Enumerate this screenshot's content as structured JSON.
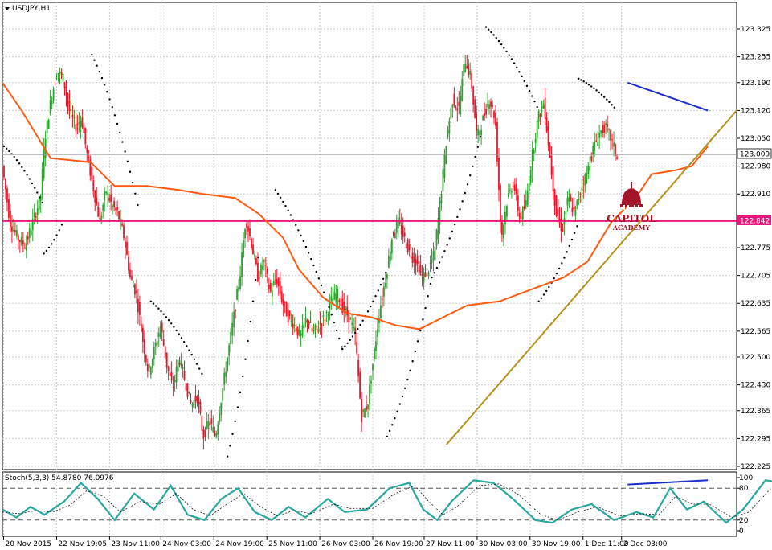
{
  "chart_data": [
    {
      "type": "line",
      "title": "USDJPY,H1",
      "price_tag_current": "123.009",
      "price_tag_level": "122.842",
      "y_ticks": [
        "123.325",
        "123.255",
        "123.190",
        "123.120",
        "123.050",
        "122.980",
        "122.910",
        "122.842",
        "122.775",
        "122.705",
        "122.635",
        "122.565",
        "122.500",
        "122.430",
        "122.365",
        "122.295",
        "122.225"
      ],
      "y_tick_values": [
        123.325,
        123.255,
        123.19,
        123.12,
        123.05,
        122.98,
        122.91,
        122.842,
        122.775,
        122.705,
        122.635,
        122.565,
        122.5,
        122.43,
        122.365,
        122.295,
        122.225
      ],
      "ylim": [
        122.215,
        123.365
      ],
      "x_ticks": [
        "20 Nov 2015",
        "22 Nov 19:05",
        "23 Nov 11:00",
        "24 Nov 03:00",
        "24 Nov 19:00",
        "25 Nov 11:00",
        "26 Nov 03:00",
        "26 Nov 19:00",
        "27 Nov 11:00",
        "30 Nov 03:00",
        "30 Nov 19:00",
        "1 Dec 11:00",
        "2 Dec 03:00"
      ],
      "horizontal_levels": [
        {
          "price": 122.842,
          "color": "#e8177a"
        },
        {
          "price": 123.009,
          "color": "#9a9a9a"
        }
      ],
      "series": [
        {
          "kind": "moving_average",
          "color": "#ff5a12",
          "points": [
            [
              0,
              123.19
            ],
            [
              12,
              123.12
            ],
            [
              30,
              123.0
            ],
            [
              55,
              122.99
            ],
            [
              70,
              122.93
            ],
            [
              90,
              122.93
            ],
            [
              110,
              122.92
            ],
            [
              125,
              122.91
            ],
            [
              145,
              122.9
            ],
            [
              160,
              122.86
            ],
            [
              175,
              122.8
            ],
            [
              185,
              122.72
            ],
            [
              200,
              122.65
            ],
            [
              215,
              122.61
            ],
            [
              230,
              122.6
            ],
            [
              245,
              122.58
            ],
            [
              260,
              122.57
            ],
            [
              275,
              122.6
            ],
            [
              290,
              122.63
            ],
            [
              310,
              122.64
            ],
            [
              330,
              122.67
            ],
            [
              350,
              122.7
            ],
            [
              365,
              122.74
            ],
            [
              380,
              122.84
            ],
            [
              395,
              122.9
            ],
            [
              405,
              122.96
            ],
            [
              420,
              122.97
            ],
            [
              430,
              122.98
            ],
            [
              440,
              123.03
            ]
          ]
        },
        {
          "kind": "trendline",
          "color": "#b8901e",
          "points": [
            [
              277,
              122.28
            ],
            [
              458,
              123.12
            ]
          ]
        },
        {
          "kind": "resistance_line",
          "color": "#1c2ec8",
          "points": [
            [
              390,
              123.19
            ],
            [
              440,
              123.12
            ]
          ]
        }
      ]
    },
    {
      "type": "line",
      "title": "Stoch(5,3,3) 54.8780 76.0976",
      "ylim": [
        0,
        100
      ],
      "y_ticks": [
        "100",
        "80",
        "20",
        "0"
      ],
      "y_tick_values": [
        100,
        80,
        20,
        0
      ],
      "levels": [
        80,
        20
      ],
      "divergence_line": {
        "color": "#1c2ec8",
        "points": [
          [
            390,
            87
          ],
          [
            440,
            95
          ]
        ]
      },
      "series": [
        {
          "kind": "main",
          "color": "#2aa8a0",
          "values": [
            [
              0,
              40
            ],
            [
              5,
              25
            ],
            [
              10,
              45
            ],
            [
              15,
              30
            ],
            [
              22,
              55
            ],
            [
              28,
              90
            ],
            [
              34,
              60
            ],
            [
              40,
              20
            ],
            [
              47,
              70
            ],
            [
              54,
              40
            ],
            [
              60,
              85
            ],
            [
              66,
              30
            ],
            [
              72,
              20
            ],
            [
              78,
              60
            ],
            [
              84,
              80
            ],
            [
              90,
              35
            ],
            [
              96,
              20
            ],
            [
              102,
              45
            ],
            [
              108,
              25
            ],
            [
              116,
              60
            ],
            [
              122,
              35
            ],
            [
              130,
              40
            ],
            [
              138,
              80
            ],
            [
              145,
              90
            ],
            [
              150,
              40
            ],
            [
              155,
              20
            ],
            [
              160,
              55
            ],
            [
              168,
              95
            ],
            [
              175,
              90
            ],
            [
              182,
              60
            ],
            [
              190,
              20
            ],
            [
              196,
              15
            ],
            [
              203,
              40
            ],
            [
              210,
              50
            ],
            [
              218,
              20
            ],
            [
              226,
              35
            ],
            [
              232,
              25
            ],
            [
              238,
              80
            ],
            [
              244,
              40
            ],
            [
              250,
              55
            ],
            [
              258,
              15
            ],
            [
              264,
              40
            ],
            [
              272,
              95
            ],
            [
              278,
              90
            ],
            [
              286,
              85
            ],
            [
              292,
              40
            ],
            [
              298,
              20
            ],
            [
              305,
              40
            ],
            [
              312,
              35
            ],
            [
              318,
              90
            ],
            [
              324,
              80
            ],
            [
              330,
              95
            ],
            [
              336,
              70
            ],
            [
              342,
              40
            ],
            [
              348,
              10
            ],
            [
              352,
              20
            ],
            [
              358,
              40
            ],
            [
              364,
              65
            ],
            [
              372,
              25
            ],
            [
              378,
              15
            ],
            [
              384,
              60
            ],
            [
              390,
              95
            ],
            [
              396,
              90
            ],
            [
              402,
              35
            ],
            [
              408,
              15
            ],
            [
              414,
              20
            ],
            [
              420,
              70
            ],
            [
              426,
              85
            ],
            [
              432,
              95
            ],
            [
              436,
              90
            ],
            [
              440,
              50
            ]
          ]
        },
        {
          "kind": "signal",
          "color": "#1a1a1a",
          "values": [
            [
              0,
              35
            ],
            [
              6,
              32
            ],
            [
              12,
              38
            ],
            [
              18,
              35
            ],
            [
              24,
              48
            ],
            [
              30,
              75
            ],
            [
              36,
              65
            ],
            [
              42,
              35
            ],
            [
              49,
              55
            ],
            [
              56,
              50
            ],
            [
              62,
              70
            ],
            [
              68,
              40
            ],
            [
              74,
              28
            ],
            [
              80,
              50
            ],
            [
              86,
              70
            ],
            [
              92,
              45
            ],
            [
              98,
              28
            ],
            [
              104,
              38
            ],
            [
              110,
              32
            ],
            [
              118,
              50
            ],
            [
              124,
              42
            ],
            [
              132,
              42
            ],
            [
              140,
              70
            ],
            [
              147,
              85
            ],
            [
              152,
              55
            ],
            [
              157,
              30
            ],
            [
              162,
              45
            ],
            [
              170,
              85
            ],
            [
              177,
              88
            ],
            [
              184,
              68
            ],
            [
              192,
              30
            ],
            [
              198,
              20
            ],
            [
              205,
              35
            ],
            [
              212,
              45
            ],
            [
              220,
              28
            ],
            [
              228,
              32
            ],
            [
              234,
              30
            ],
            [
              240,
              65
            ],
            [
              246,
              50
            ],
            [
              252,
              50
            ],
            [
              260,
              25
            ],
            [
              266,
              35
            ],
            [
              274,
              80
            ],
            [
              280,
              88
            ],
            [
              288,
              85
            ],
            [
              294,
              55
            ],
            [
              300,
              30
            ],
            [
              307,
              38
            ],
            [
              314,
              38
            ],
            [
              320,
              80
            ],
            [
              326,
              82
            ],
            [
              332,
              90
            ],
            [
              338,
              78
            ],
            [
              344,
              50
            ],
            [
              350,
              20
            ],
            [
              354,
              20
            ],
            [
              360,
              35
            ],
            [
              366,
              55
            ],
            [
              374,
              35
            ],
            [
              380,
              22
            ],
            [
              386,
              50
            ],
            [
              392,
              85
            ],
            [
              398,
              90
            ],
            [
              404,
              50
            ],
            [
              410,
              25
            ],
            [
              416,
              20
            ],
            [
              422,
              55
            ],
            [
              428,
              78
            ],
            [
              434,
              90
            ],
            [
              438,
              88
            ],
            [
              440,
              70
            ]
          ]
        }
      ]
    }
  ],
  "logo": {
    "line1": "CAPITOL",
    "line2": "ACADEMY",
    "color": "#a3162a"
  },
  "colors": {
    "bull": "#2fa12f",
    "bear": "#e8172a",
    "sar": "#000000",
    "grid": "#c8c8c8"
  }
}
